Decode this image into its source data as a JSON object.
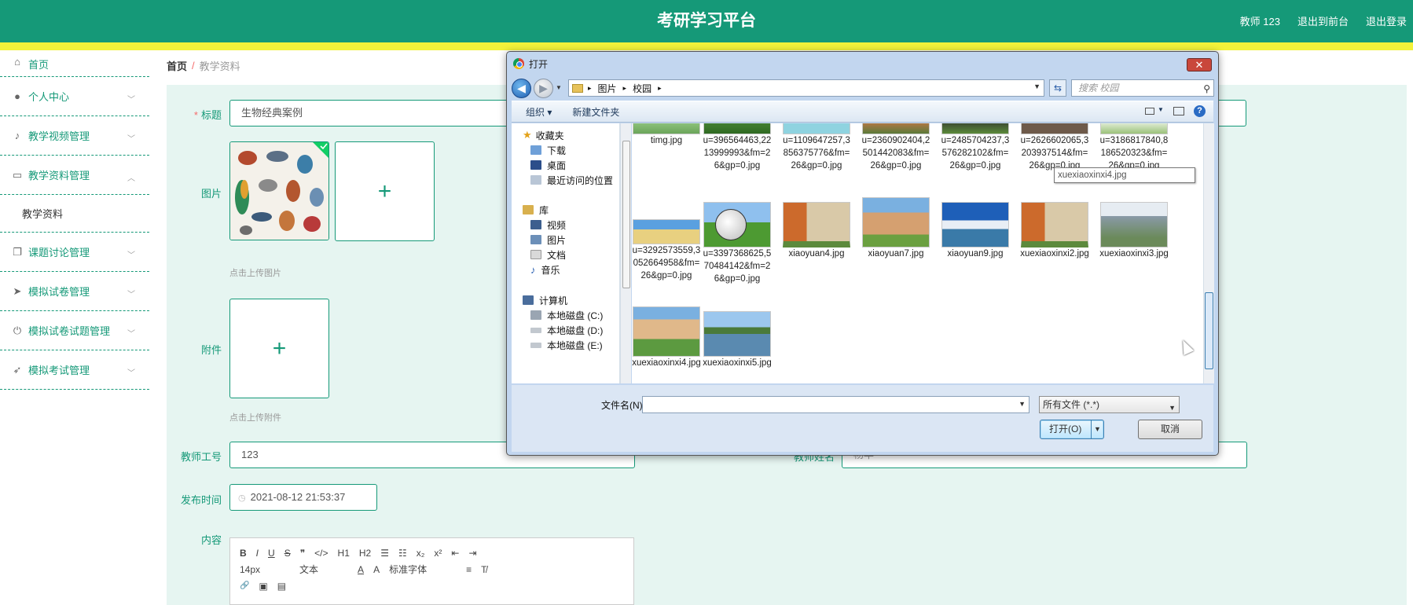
{
  "header": {
    "title": "考研学习平台",
    "user": "教师 123",
    "front_link": "退出到前台",
    "logout": "退出登录"
  },
  "sidebar": {
    "items": [
      {
        "label": "首页",
        "icon": "home-icon"
      },
      {
        "label": "个人中心",
        "icon": "user-icon"
      },
      {
        "label": "教学视频管理",
        "icon": "mic-icon"
      },
      {
        "label": "教学资料管理",
        "icon": "chat-icon"
      },
      {
        "label": "课题讨论管理",
        "icon": "copy-icon"
      },
      {
        "label": "模拟试卷管理",
        "icon": "send-icon"
      },
      {
        "label": "模拟试卷试题管理",
        "icon": "power-icon"
      },
      {
        "label": "模拟考试管理",
        "icon": "navigation-icon"
      }
    ],
    "submenu": "教学资料"
  },
  "breadcrumb": {
    "home": "首页",
    "sep": "/",
    "current": "教学资料"
  },
  "form": {
    "title_label": "标题",
    "title_value": "生物经典案例",
    "image_label": "图片",
    "image_hint": "点击上传图片",
    "attach_label": "附件",
    "attach_hint": "点击上传附件",
    "teacher_id_label": "教师工号",
    "teacher_id_value": "123",
    "teacher_name_label": "教师姓名",
    "teacher_name_value": "杨华",
    "time_label": "发布时间",
    "time_value": "2021-08-12 21:53:37",
    "content_label": "内容",
    "plus": "+"
  },
  "editor": {
    "row1": [
      "B",
      "I",
      "U",
      "S",
      "❞",
      "</>",
      "H1",
      "H2",
      "☰",
      "☷",
      "x₂",
      "x²",
      "⇤",
      "⇥"
    ],
    "font_size": "14px",
    "font_kind": "文本",
    "font_face": "标准字体",
    "row3": [
      "🔗",
      "▣",
      "▤"
    ]
  },
  "dialog": {
    "title": "打开",
    "close": "✕",
    "path": [
      "图片",
      "校园"
    ],
    "search_placeholder": "搜索 校园",
    "organize": "组织 ▾",
    "new_folder": "新建文件夹",
    "nav": {
      "favorites": "收藏夹",
      "downloads": "下载",
      "desktop": "桌面",
      "recent": "最近访问的位置",
      "library": "库",
      "video": "视频",
      "pictures": "图片",
      "docs": "文档",
      "music": "音乐",
      "computer": "计算机",
      "c": "本地磁盘 (C:)",
      "d": "本地磁盘 (D:)",
      "e": "本地磁盘 (E:)"
    },
    "files_row1": [
      "timg.jpg",
      "u=396564463,2213999993&fm=26&gp=0.jpg",
      "u=1109647257,3856375776&fm=26&gp=0.jpg",
      "u=2360902404,2501442083&fm=26&gp=0.jpg",
      "u=2485704237,3576282102&fm=26&gp=0.jpg",
      "u=2626602065,3203937514&fm=26&gp=0.jpg",
      "u=3186817840,8186520323&fm=26&gp=0.jpg"
    ],
    "files_row2": [
      "u=3292573559,3052664958&fm=26&gp=0.jpg",
      "u=3397368625,570484142&fm=26&gp=0.jpg",
      "xiaoyuan4.jpg",
      "xiaoyuan7.jpg",
      "xiaoyuan9.jpg",
      "xuexiaoxinxi2.jpg",
      "xuexiaoxinxi3.jpg"
    ],
    "files_row3": [
      "xuexiaoxinxi4.jpg",
      "xuexiaoxinxi5.jpg"
    ],
    "tooltip": "xuexiaoxinxi4.jpg",
    "filename_label": "文件名(N):",
    "filetype": "所有文件 (*.*)",
    "open_btn": "打开(O)",
    "cancel_btn": "取消"
  }
}
